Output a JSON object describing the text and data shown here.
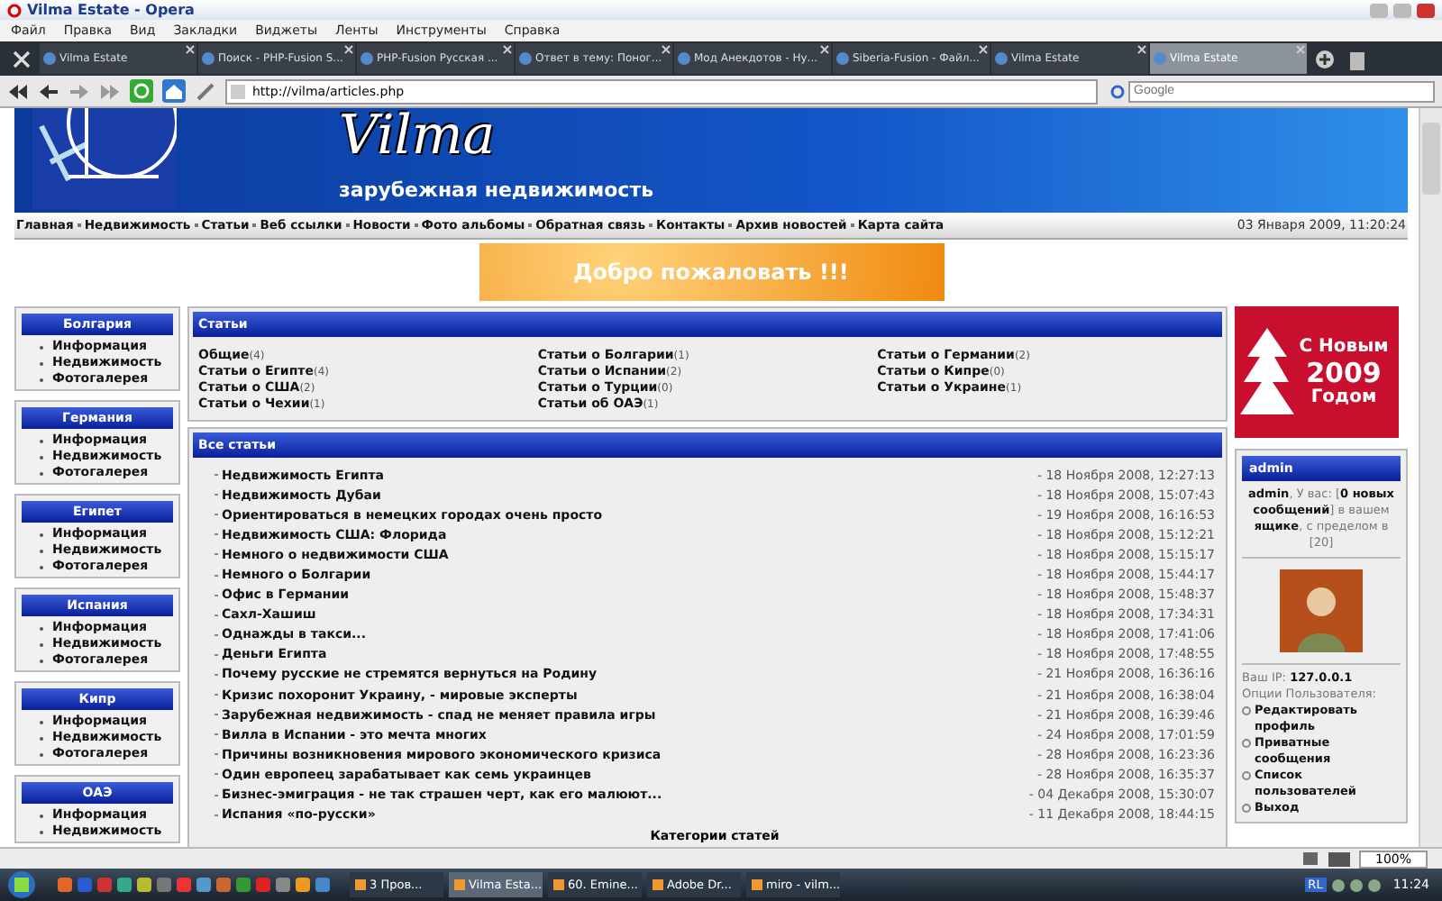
{
  "window": {
    "title": "Vilma Estate - Opera"
  },
  "menu": [
    "Файл",
    "Правка",
    "Вид",
    "Закладки",
    "Виджеты",
    "Ленты",
    "Инструменты",
    "Справка"
  ],
  "tabs": [
    {
      "label": "Vilma Estate",
      "selected": false
    },
    {
      "label": "Поиск - PHP-Fusion S...",
      "selected": false
    },
    {
      "label": "PHP-Fusion Русская ...",
      "selected": false
    },
    {
      "label": "Ответ в тему: Поног...",
      "selected": false
    },
    {
      "label": "Мод Анекдотов - Ну...",
      "selected": false
    },
    {
      "label": "Siberia-Fusion - Файл...",
      "selected": false
    },
    {
      "label": "Vilma Estate",
      "selected": false
    },
    {
      "label": "Vilma Estate",
      "selected": true
    }
  ],
  "address_bar": {
    "url": "http://vilma/articles.php",
    "search_placeholder": "Google"
  },
  "site": {
    "logo": "Vilma",
    "tagline": "зарубежная недвижимость",
    "nav": [
      "Главная",
      "Недвижимость",
      "Статьи",
      "Веб ссылки",
      "Новости",
      "Фото альбомы",
      "Обратная связь",
      "Контакты",
      "Архив новостей",
      "Карта сайта"
    ],
    "date": "03 Января 2009, 11:20:24",
    "banner": "Добро пожаловать !!!"
  },
  "left_sidebar": [
    {
      "title": "Болгария",
      "items": [
        "Информация",
        "Недвижимость",
        "Фотогалерея"
      ]
    },
    {
      "title": "Германия",
      "items": [
        "Информация",
        "Недвижимость",
        "Фотогалерея"
      ]
    },
    {
      "title": "Египет",
      "items": [
        "Информация",
        "Недвижимость",
        "Фотогалерея"
      ]
    },
    {
      "title": "Испания",
      "items": [
        "Информация",
        "Недвижимость",
        "Фотогалерея"
      ]
    },
    {
      "title": "Кипр",
      "items": [
        "Информация",
        "Недвижимость",
        "Фотогалерея"
      ]
    },
    {
      "title": "ОАЭ",
      "items": [
        "Информация",
        "Недвижимость"
      ]
    }
  ],
  "categories": {
    "title": "Статьи",
    "columns": [
      [
        {
          "name": "Общие",
          "count": "(4)"
        },
        {
          "name": "Статьи о Египте",
          "count": "(4)"
        },
        {
          "name": "Статьи о США",
          "count": "(2)"
        },
        {
          "name": "Статьи о Чехии",
          "count": "(1)"
        }
      ],
      [
        {
          "name": "Статьи о Болгарии",
          "count": "(1)"
        },
        {
          "name": "Статьи о Испании",
          "count": "(2)"
        },
        {
          "name": "Статьи о Турции",
          "count": "(0)"
        },
        {
          "name": "Статьи об ОАЭ",
          "count": "(1)"
        }
      ],
      [
        {
          "name": "Статьи о Германии",
          "count": "(2)"
        },
        {
          "name": "Статьи о Кипре",
          "count": "(0)"
        },
        {
          "name": "Статьи о Украине",
          "count": "(1)"
        }
      ]
    ]
  },
  "articles": {
    "title": "Все статьи",
    "rows": [
      {
        "title": "Недвижимость Египта",
        "date": "- 18 Ноября 2008, 12:27:13"
      },
      {
        "title": "Недвижимость Дубаи",
        "date": "- 18 Ноября 2008, 15:07:43"
      },
      {
        "title": "Ориентироваться в немецких городах очень просто",
        "date": "- 19 Ноября 2008, 16:16:53"
      },
      {
        "title": "Недвижимость США: Флорида",
        "date": "- 18 Ноября 2008, 15:12:21"
      },
      {
        "title": "Немного о недвижимости США",
        "date": "- 18 Ноября 2008, 15:15:17"
      },
      {
        "title": "Немного о Болгарии",
        "date": "- 18 Ноября 2008, 15:44:17"
      },
      {
        "title": "Офис в Германии",
        "date": "- 18 Ноября 2008, 15:48:37"
      },
      {
        "title": "Сахл-Хашиш",
        "date": "- 18 Ноября 2008, 17:34:31"
      },
      {
        "title": "Однажды в такси...",
        "date": "- 18 Ноября 2008, 17:41:06"
      },
      {
        "title": "Деньги Египта",
        "date": "- 18 Ноября 2008, 17:48:55"
      },
      {
        "title": "Почему русские не стремятся вернуться на Родину",
        "date": "- 21 Ноября 2008, 16:36:16"
      },
      {
        "title": "Кризис похоронит Украину, - мировые эксперты",
        "date": "- 21 Ноября 2008, 16:38:04"
      },
      {
        "title": "Зарубежная недвижимость - спад не меняет правила игры",
        "date": "- 21 Ноября 2008, 16:39:46"
      },
      {
        "title": "Вилла в Испании - это мечта многих",
        "date": "- 24 Ноября 2008, 17:01:59"
      },
      {
        "title": "Причины возникновения мирового экономического кризиса",
        "date": "- 28 Ноября 2008, 16:23:36"
      },
      {
        "title": "Один европеец зарабатывает как семь украинцев",
        "date": "- 28 Ноября 2008, 16:35:37"
      },
      {
        "title": "Бизнес-эмиграция - не так страшен черт, как его малюют...",
        "date": "- 04 Декабря 2008, 15:30:07"
      },
      {
        "title": "Испания «по-русски»",
        "date": "- 11 Декабря 2008, 18:44:15"
      }
    ],
    "footer": "Категории статей"
  },
  "right_sidebar": {
    "greeting_lines": [
      "С Новым",
      "2009",
      "Годом"
    ],
    "user_panel": {
      "title": "admin",
      "message": "**admin**, У вас: [**0 новых сообщений**] в вашем **ящике**, с пределом в [20]",
      "ip": "Ваш IP: **127.0.0.1**",
      "options_label": "Опции Пользователя:",
      "links": [
        "Редактировать профиль",
        "Приватные сообщения",
        "Список пользователей",
        "Выход"
      ]
    }
  },
  "status_bar": {
    "zoom": "100%"
  },
  "taskbar": {
    "items": [
      {
        "label": "3 Пров...",
        "selected": false
      },
      {
        "label": "Vilma Esta...",
        "selected": true
      },
      {
        "label": "60. Emine...",
        "selected": false
      },
      {
        "label": "Adobe Dr...",
        "selected": false
      },
      {
        "label": "miro - vilm...",
        "selected": false
      }
    ],
    "language": "RL",
    "clock": "11:24"
  }
}
